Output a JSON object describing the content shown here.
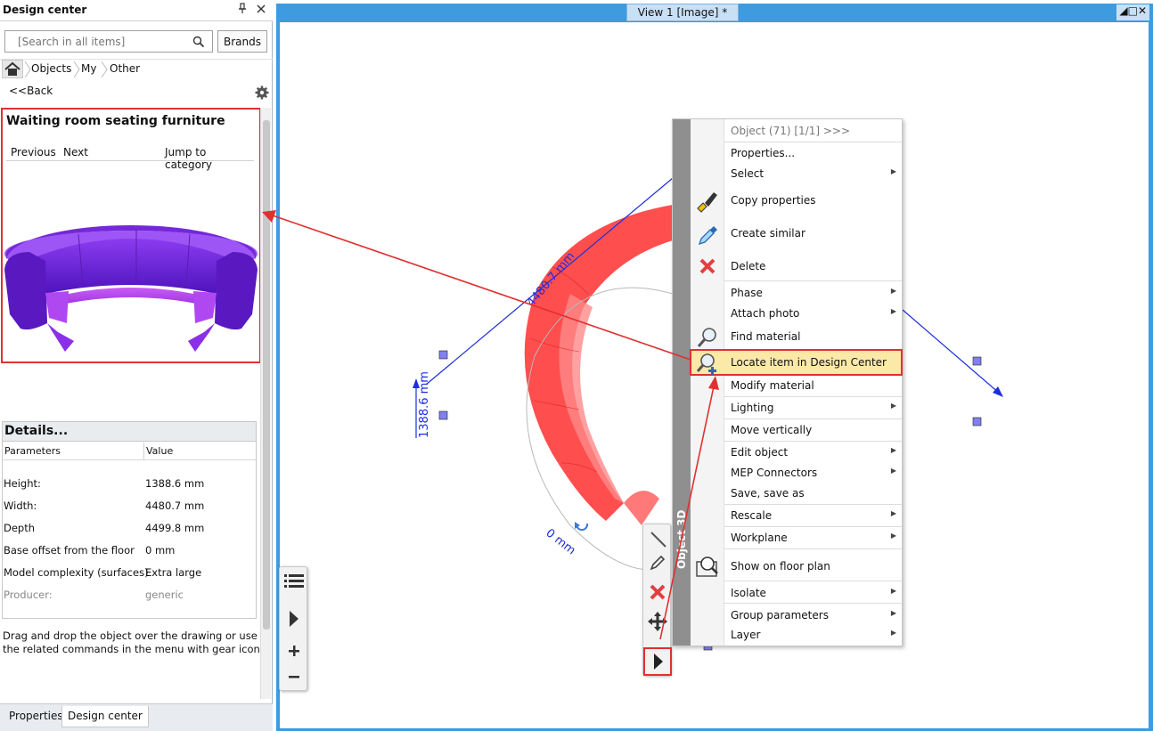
{
  "panel": {
    "title": "Design center",
    "pin_icon": "pin-icon",
    "close_icon": "close-icon",
    "search_placeholder": "[Search in all items]",
    "brands_label": "Brands",
    "breadcrumb": [
      "Objects",
      "My",
      "Other"
    ],
    "back_label": "<<Back",
    "item_title": "Waiting room seating furniture",
    "nav": {
      "previous": "Previous",
      "next": "Next",
      "jump": "Jump to category"
    },
    "details": {
      "title": "Details...",
      "col_param": "Parameters",
      "col_value": "Value",
      "rows": [
        {
          "name": "Height:",
          "value": "1388.6 mm"
        },
        {
          "name": "Width:",
          "value": "4480.7 mm"
        },
        {
          "name": "Depth",
          "value": "4499.8 mm"
        },
        {
          "name": "Base offset from the floor",
          "value": "0 mm"
        },
        {
          "name": "Model complexity (surfaces)",
          "value": "Extra large"
        },
        {
          "name": "Producer:",
          "value": "generic"
        }
      ]
    },
    "hint": "Drag and drop the object over the drawing or use the related commands in the menu with gear icon",
    "tabs": [
      "Properties",
      "Design center"
    ],
    "furniture_color": "#7a2be8"
  },
  "view": {
    "tab_label": "View 1 [Image] *",
    "controls": "◢□✕",
    "dims": {
      "width": "4480.7 mm",
      "height": "1388.6 mm",
      "angle": "0 mm"
    },
    "accent_color": "#3d9be0"
  },
  "obj3d_toolbar": {
    "label": "Object 3D"
  },
  "menu": {
    "header": "Object (71) [1/1] >>>",
    "items": {
      "properties": "Properties...",
      "select": "Select",
      "copy_properties": "Copy properties",
      "create_similar": "Create similar",
      "delete": "Delete",
      "phase": "Phase",
      "attach_photo": "Attach photo",
      "find_material": "Find material",
      "locate_item": "Locate item in Design Center",
      "modify_material": "Modify material",
      "lighting": "Lighting",
      "move_vertically": "Move vertically",
      "edit_object": "Edit object",
      "mep_connectors": "MEP Connectors",
      "save_as": "Save, save as",
      "rescale": "Rescale",
      "workplane": "Workplane",
      "show_floor_plan": "Show on floor plan",
      "isolate": "Isolate",
      "group_parameters": "Group parameters",
      "layer": "Layer"
    },
    "highlight_color": "#fbe9a8",
    "annotation_color": "#e03030"
  }
}
